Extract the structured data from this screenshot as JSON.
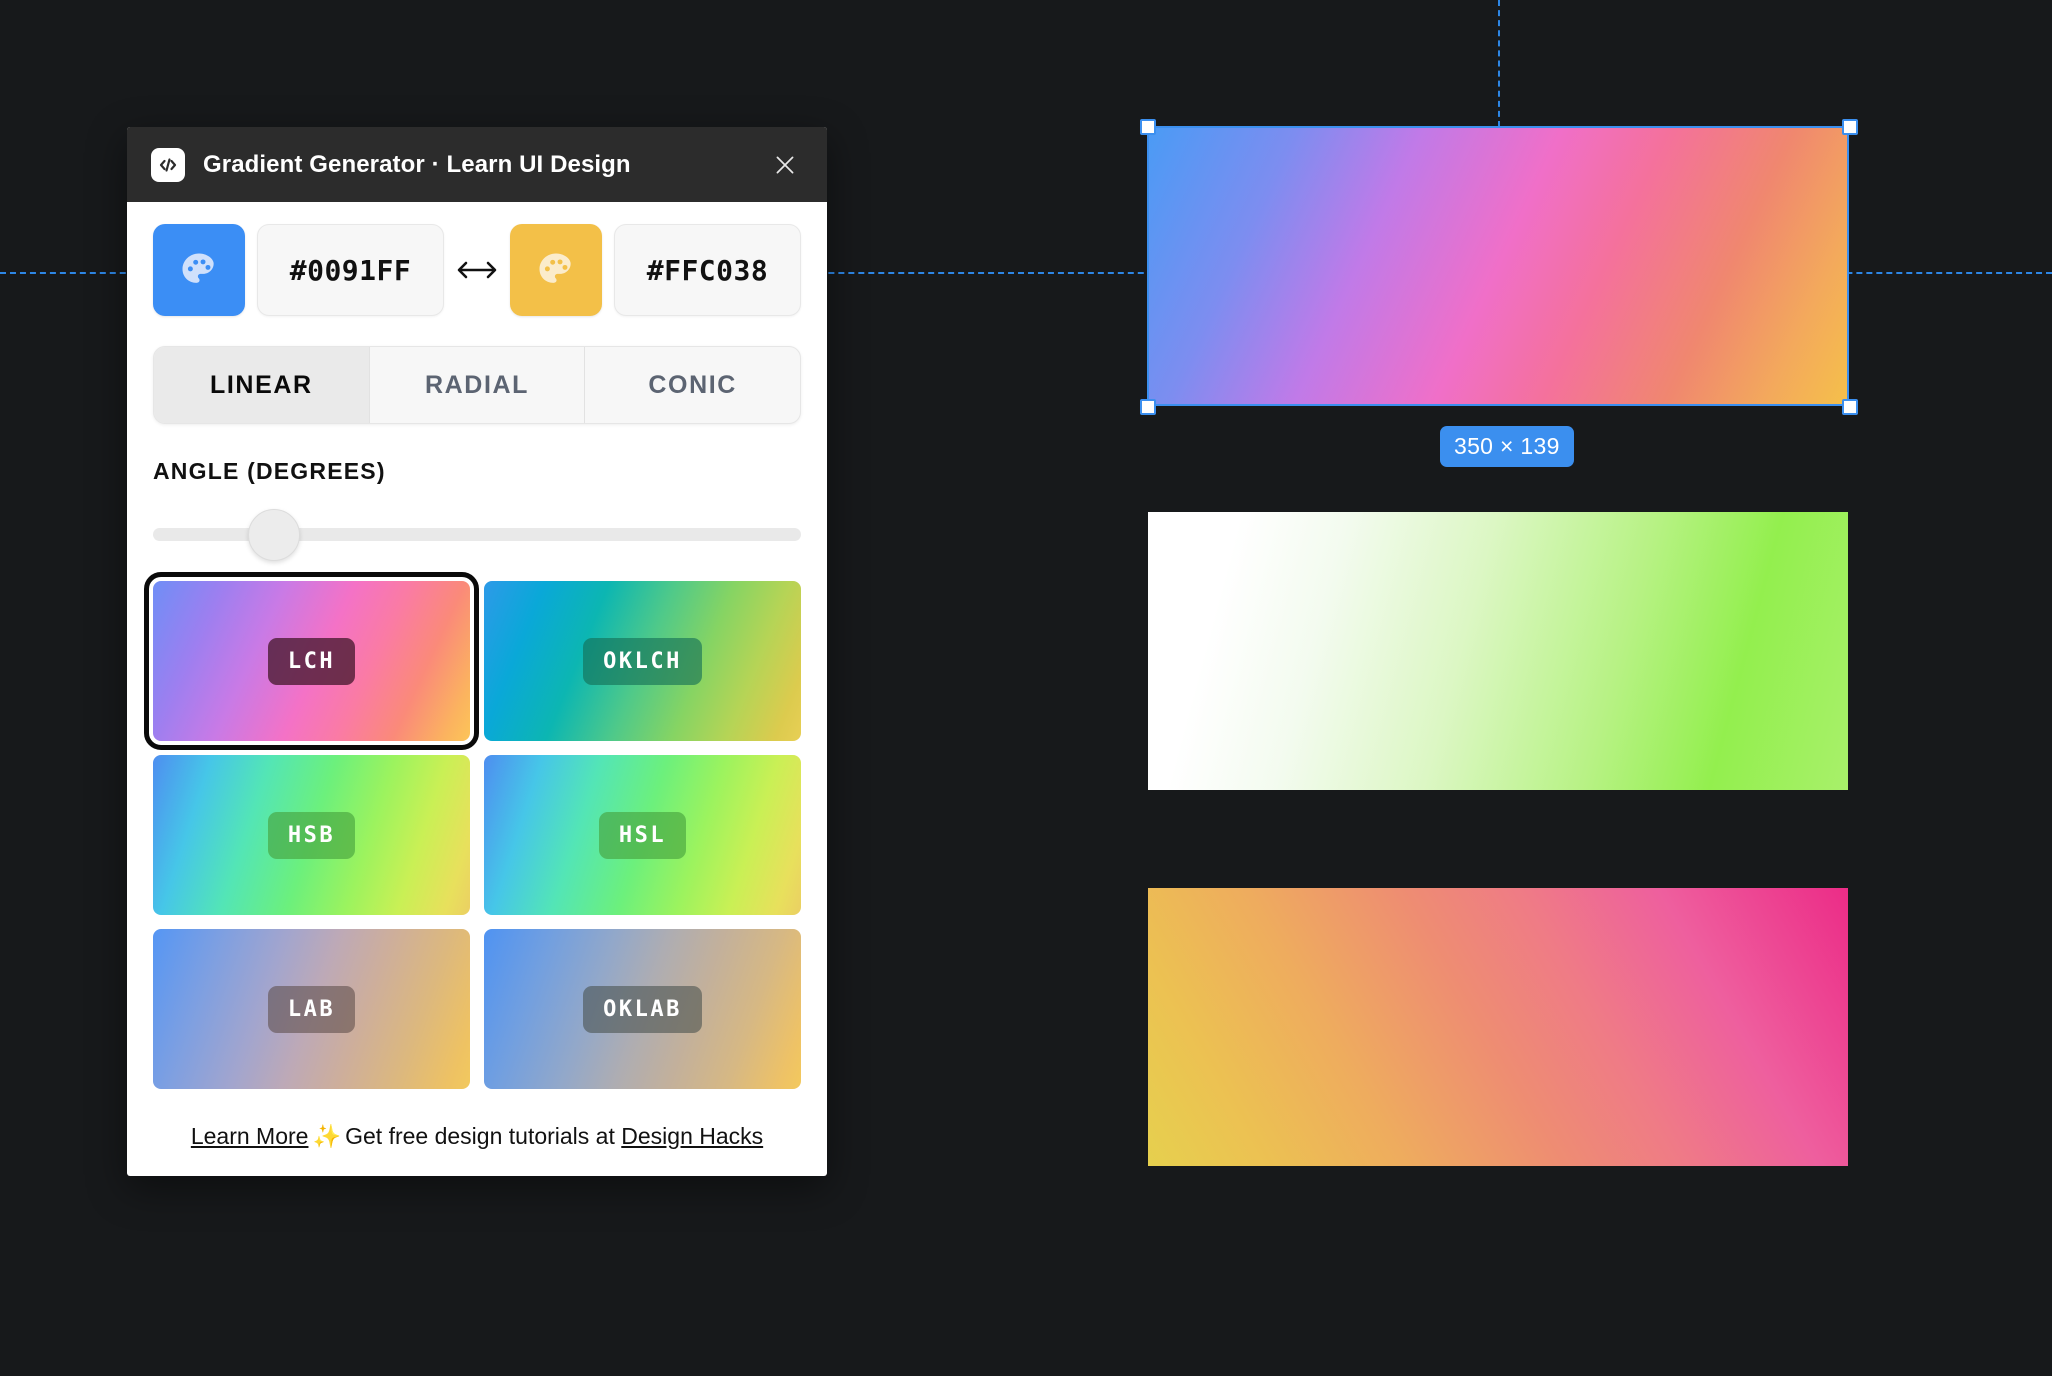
{
  "canvas": {
    "background": "#17191b",
    "guide_color": "#2f8cf0"
  },
  "panel": {
    "icon": "code-icon",
    "title": "Gradient Generator · Learn UI Design",
    "close_icon": "close-icon",
    "colors": {
      "start": {
        "icon": "palette-icon",
        "hex": "#0091FF",
        "placeholder": "#0091FF",
        "swatch_color": "#3b8ef5"
      },
      "swap_icon": "swap-horizontal-icon",
      "end": {
        "icon": "palette-icon",
        "hex": "#FFC038",
        "placeholder": "#FFC038",
        "swatch_color": "#f3c048"
      }
    },
    "tabs": [
      {
        "label": "LINEAR",
        "active": true
      },
      {
        "label": "RADIAL",
        "active": false
      },
      {
        "label": "CONIC",
        "active": false
      }
    ],
    "angle": {
      "label": "ANGLE (DEGREES)",
      "percent": 18.5
    },
    "modes": [
      {
        "label": "LCH",
        "selected": true
      },
      {
        "label": "OKLCH",
        "selected": false
      },
      {
        "label": "HSB",
        "selected": false
      },
      {
        "label": "HSL",
        "selected": false
      },
      {
        "label": "LAB",
        "selected": false
      },
      {
        "label": "OKLAB",
        "selected": false
      }
    ],
    "footer": {
      "link_1": "Learn More",
      "sparkle": "✨",
      "text": "Get free design tutorials at",
      "link_2": "Design Hacks"
    }
  },
  "artboards": {
    "selected": {
      "name": "lch-gradient-rect",
      "badge": "350 × 139",
      "badge_color": "#3b8fef"
    },
    "second": {
      "name": "white-green-gradient-rect"
    },
    "third": {
      "name": "yellow-pink-gradient-rect"
    }
  }
}
